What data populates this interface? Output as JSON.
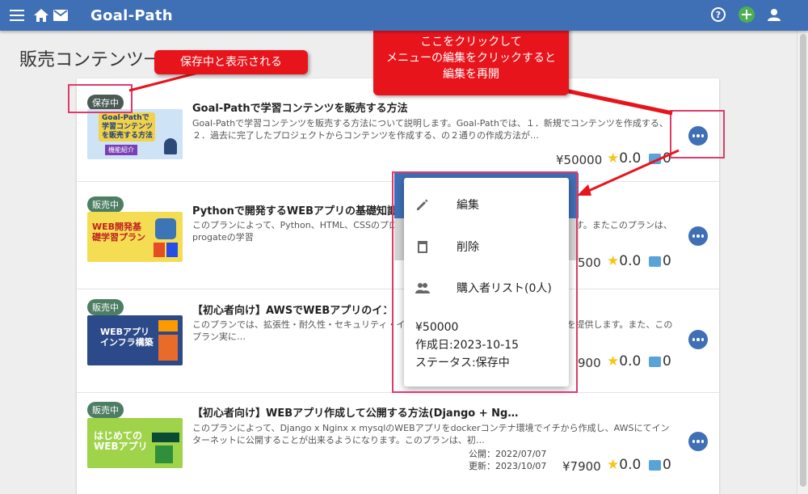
{
  "app": {
    "brand": "Goal-Path",
    "page_title": "販売コンテンツ一覧"
  },
  "items": [
    {
      "badge": "保存中",
      "title": "Goal-Pathで学習コンテンツを販売する方法",
      "desc": "Goal-Pathで学習コンテンツを販売する方法について説明します。Goal-Pathでは、１．新規でコンテンツを作成する、２．過去に完了したプロジェクトからコンテンツを作成する、の２通りの作成方法が…",
      "price": "¥50000",
      "stars": "0.0",
      "comments": "0",
      "thumb_text": "Goal-Pathで学習コンテンツを販売する方法",
      "thumb_tag": "機能紹介"
    },
    {
      "badge": "販売中",
      "title": "Pythonで開発するWEBアプリの基礎知識を",
      "desc": "このプランによって、Python、HTML、CSSのプログラミングの基礎を身に付けることが出来ます。またこのプランは、progateの学習",
      "price": "500",
      "stars": "0.0",
      "comments": "0",
      "thumb_text": "WEB開発基礎学習プラン"
    },
    {
      "badge": "販売中",
      "title": "【初心者向け】AWSでWEBアプリのインフ",
      "desc": "このプランでは、拡張性・耐久性・セキュリティ・インフラを、AWSを使用して構築する方法を提供します。また、このプラン実に…",
      "price": "900",
      "stars": "0.0",
      "comments": "0",
      "thumb_text": "WEBアプリインフラ構築"
    },
    {
      "badge": "販売中",
      "title": "【初心者向け】WEBアプリ作成して公開する方法(Django + Ng…",
      "desc": "このプランによって、Django x Nginx x mysqlのWEBアプリをdockerコンテナ環境でイチから作成し、AWSにてインターネットに公開することが出来るようになります。このプランは、初…",
      "published": "公開：2022/07/07",
      "updated": "更新：2023/10/07",
      "price": "¥7900",
      "stars": "0.0",
      "comments": "0",
      "thumb_text": "はじめてのWEBアプリ"
    }
  ],
  "menu": {
    "edit": "編集",
    "delete": "削除",
    "buyers": "購入者リスト(0人)",
    "price": "¥50000",
    "created": "作成日:2023-10-15",
    "status": "ステータス:保存中"
  },
  "annotations": {
    "saved_callout": "保存中と表示される",
    "menu_callout_line1": "ここをクリックして",
    "menu_callout_line2": "メニューの編集をクリックすると",
    "menu_callout_line3": "編集を再開"
  },
  "colors": {
    "appbar": "#3f6fb5",
    "callout": "#e8141c",
    "highlight": "#e03a6b",
    "badge_sale": "#4d7d63",
    "star": "#f5c518"
  }
}
